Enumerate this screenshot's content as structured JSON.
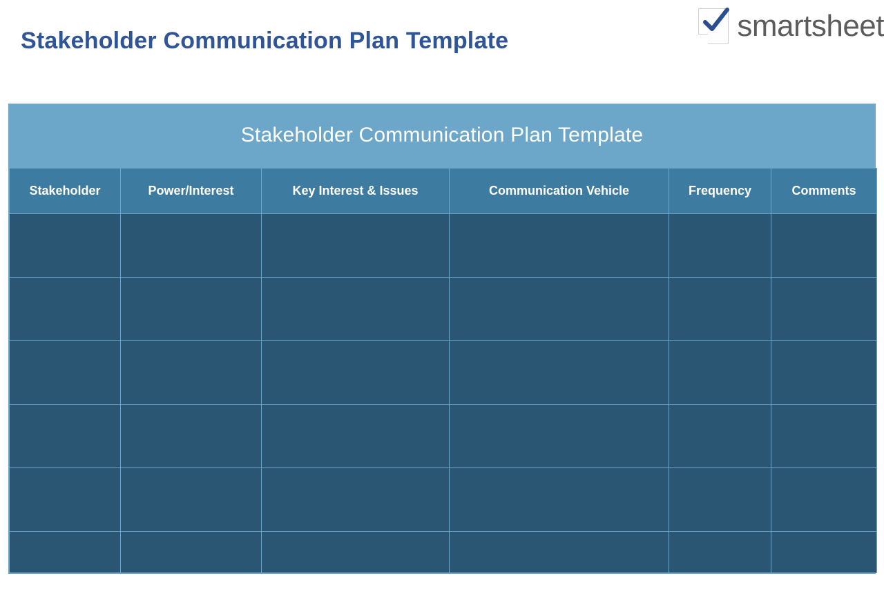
{
  "document": {
    "title": "Stakeholder Communication Plan Template"
  },
  "brand": {
    "name": "smartsheet",
    "icon": "checkmark-page-icon"
  },
  "table": {
    "banner_title": "Stakeholder Communication Plan Template",
    "columns": [
      "Stakeholder",
      "Power/Interest",
      "Key Interest & Issues",
      "Communication Vehicle",
      "Frequency",
      "Comments"
    ],
    "rows": [
      [
        "",
        "",
        "",
        "",
        "",
        ""
      ],
      [
        "",
        "",
        "",
        "",
        "",
        ""
      ],
      [
        "",
        "",
        "",
        "",
        "",
        ""
      ],
      [
        "",
        "",
        "",
        "",
        "",
        ""
      ],
      [
        "",
        "",
        "",
        "",
        "",
        ""
      ],
      [
        "",
        "",
        "",
        "",
        "",
        ""
      ]
    ]
  },
  "colors": {
    "title": "#2f5597",
    "banner_bg": "#6ca6c9",
    "header_bg": "#3e7ba0",
    "cell_bg": "#2a5673",
    "border": "#6ca6c9",
    "brand_text": "#5c5c5c",
    "check": "#2a4e8f"
  }
}
